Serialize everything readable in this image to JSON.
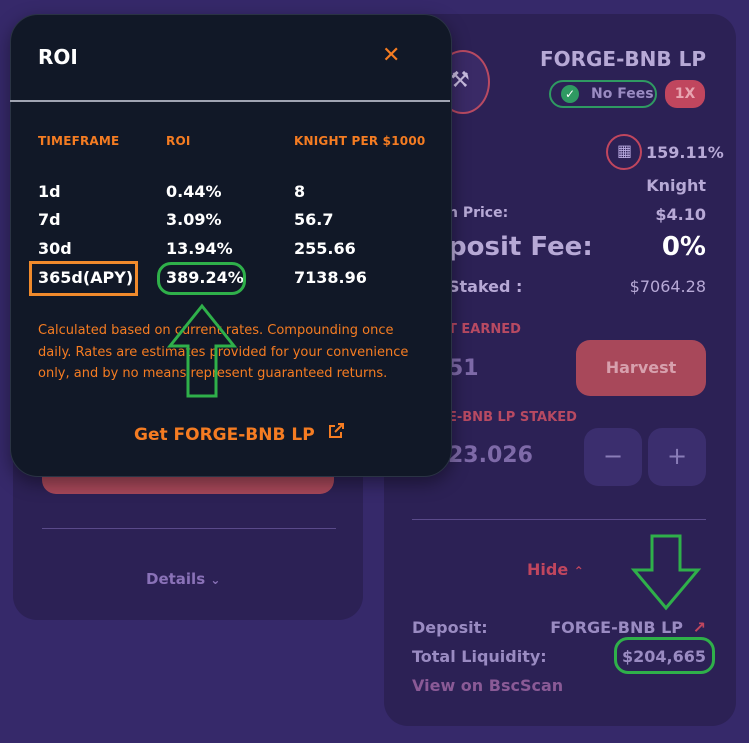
{
  "modal": {
    "title": "ROI",
    "close_icon": "close-icon",
    "columns": [
      "TIMEFRAME",
      "ROI",
      "KNIGHT PER $1000"
    ],
    "rows": [
      {
        "timeframe": "1d",
        "roi": "0.44%",
        "per1000": "8"
      },
      {
        "timeframe": "7d",
        "roi": "3.09%",
        "per1000": "56.7"
      },
      {
        "timeframe": "30d",
        "roi": "13.94%",
        "per1000": "255.66"
      },
      {
        "timeframe": "365d(APY)",
        "roi": "389.24%",
        "per1000": "7138.96"
      }
    ],
    "note": "Calculated based on current rates. Compounding once daily. Rates are estimates provided for your convenience only, and by no means represent guaranteed returns.",
    "get_link": "Get FORGE-BNB LP"
  },
  "farm": {
    "title": "FORGE-BNB LP",
    "badge_nofees": "No Fees",
    "badge_multiplier": "1X",
    "apr": "159.11%",
    "earn_value": "Knight",
    "price_label": "n Price:",
    "price_value": "$4.10",
    "fee_label": "posit Fee:",
    "fee_value": "0%",
    "staked_label": "Staked :",
    "staked_value": "$7064.28",
    "earned_label": "T EARNED",
    "earned_value": "51",
    "harvest_label": "Harvest",
    "lp_staked_label": "E-BNB LP STAKED",
    "lp_staked_value": "23.026",
    "minus": "−",
    "plus": "+",
    "hide_label": "Hide",
    "deposit_label": "Deposit:",
    "deposit_value": "FORGE-BNB LP",
    "liquidity_label": "Total Liquidity:",
    "liquidity_value": "$204,665",
    "bscscan_link": "View on BscScan"
  },
  "left_card": {
    "details_label": "Details"
  },
  "colors": {
    "accent_orange": "#f57c22",
    "highlight_green": "#2fb04a",
    "modal_bg": "#111827",
    "page_bg": "#36296a",
    "card_bg": "#2c2155"
  }
}
